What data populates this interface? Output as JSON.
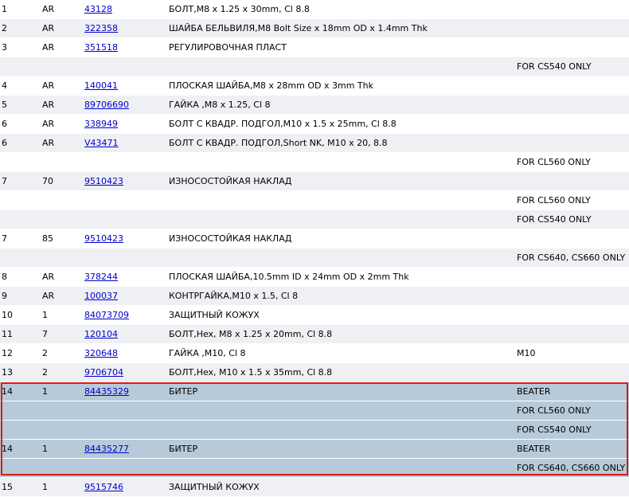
{
  "rows": [
    {
      "no": "1",
      "qty": "AR",
      "part": "43128",
      "desc": "БОЛТ,M8 x 1.25 x 30mm, Cl 8.8",
      "remark": ""
    },
    {
      "no": "2",
      "qty": "AR",
      "part": "322358",
      "desc": "ШАЙБА БЕЛЬВИЛЯ,M8 Bolt Size x 18mm OD x 1.4mm Thk",
      "remark": ""
    },
    {
      "no": "3",
      "qty": "AR",
      "part": "351518",
      "desc": "РЕГУЛИРОВОЧНАЯ ПЛАСТ",
      "remark": ""
    },
    {
      "no": "",
      "qty": "",
      "part": "",
      "desc": "",
      "remark": "FOR CS540 ONLY"
    },
    {
      "no": "4",
      "qty": "AR",
      "part": "140041",
      "desc": "ПЛОСКАЯ ШАЙБА,M8 x 28mm OD x 3mm Thk",
      "remark": ""
    },
    {
      "no": "5",
      "qty": "AR",
      "part": "89706690",
      "desc": "ГАЙКА ,M8 x 1.25, Cl 8",
      "remark": ""
    },
    {
      "no": "6",
      "qty": "AR",
      "part": "338949",
      "desc": "БОЛТ С КВАДР. ПОДГОЛ,M10 x 1.5 x 25mm, Cl 8.8",
      "remark": ""
    },
    {
      "no": "6",
      "qty": "AR",
      "part": "V43471",
      "desc": "БОЛТ С КВАДР. ПОДГОЛ,Short NK, M10 x 20, 8.8",
      "remark": ""
    },
    {
      "no": "",
      "qty": "",
      "part": "",
      "desc": "",
      "remark": "FOR CL560 ONLY"
    },
    {
      "no": "7",
      "qty": "70",
      "part": "9510423",
      "desc": "ИЗНОСОСТОЙКАЯ НАКЛАД",
      "remark": ""
    },
    {
      "no": "",
      "qty": "",
      "part": "",
      "desc": "",
      "remark": "FOR CL560 ONLY"
    },
    {
      "no": "",
      "qty": "",
      "part": "",
      "desc": "",
      "remark": "FOR CS540 ONLY"
    },
    {
      "no": "7",
      "qty": "85",
      "part": "9510423",
      "desc": "ИЗНОСОСТОЙКАЯ НАКЛАД",
      "remark": ""
    },
    {
      "no": "",
      "qty": "",
      "part": "",
      "desc": "",
      "remark": "FOR CS640, CS660 ONLY"
    },
    {
      "no": "8",
      "qty": "AR",
      "part": "378244",
      "desc": "ПЛОСКАЯ ШАЙБА,10.5mm ID x 24mm OD x 2mm Thk",
      "remark": ""
    },
    {
      "no": "9",
      "qty": "AR",
      "part": "100037",
      "desc": "КОНТРГАЙКА,M10 x 1.5, Cl 8",
      "remark": ""
    },
    {
      "no": "10",
      "qty": "1",
      "part": "84073709",
      "desc": "ЗАЩИТНЫЙ КОЖУХ",
      "remark": ""
    },
    {
      "no": "11",
      "qty": "7",
      "part": "120104",
      "desc": "БОЛТ,Hex, M8 x 1.25 x 20mm, Cl 8.8",
      "remark": ""
    },
    {
      "no": "12",
      "qty": "2",
      "part": "320648",
      "desc": "ГАЙКА ,M10, Cl 8",
      "remark": "M10"
    },
    {
      "no": "13",
      "qty": "2",
      "part": "9706704",
      "desc": "БОЛТ,Hex, M10 x 1.5 x 35mm, Cl 8.8",
      "remark": ""
    },
    {
      "no": "14",
      "qty": "1",
      "part": "84435329",
      "desc": "БИТЕР",
      "remark": "BEATER",
      "selected": true
    },
    {
      "no": "",
      "qty": "",
      "part": "",
      "desc": "",
      "remark": "FOR CL560 ONLY",
      "selected": true
    },
    {
      "no": "",
      "qty": "",
      "part": "",
      "desc": "",
      "remark": "FOR CS540 ONLY",
      "selected": true
    },
    {
      "no": "14",
      "qty": "1",
      "part": "84435277",
      "desc": "БИТЕР",
      "remark": "BEATER",
      "selected": true
    },
    {
      "no": "",
      "qty": "",
      "part": "",
      "desc": "",
      "remark": "FOR CS640, CS660 ONLY",
      "selected": true
    },
    {
      "no": "15",
      "qty": "1",
      "part": "9515746",
      "desc": "ЗАЩИТНЫЙ КОЖУХ",
      "remark": ""
    }
  ],
  "colors": {
    "row_alt": "#eef0f4",
    "row_selected": "#b7cad9",
    "highlight_border": "#e01818",
    "link": "#0000cc"
  }
}
